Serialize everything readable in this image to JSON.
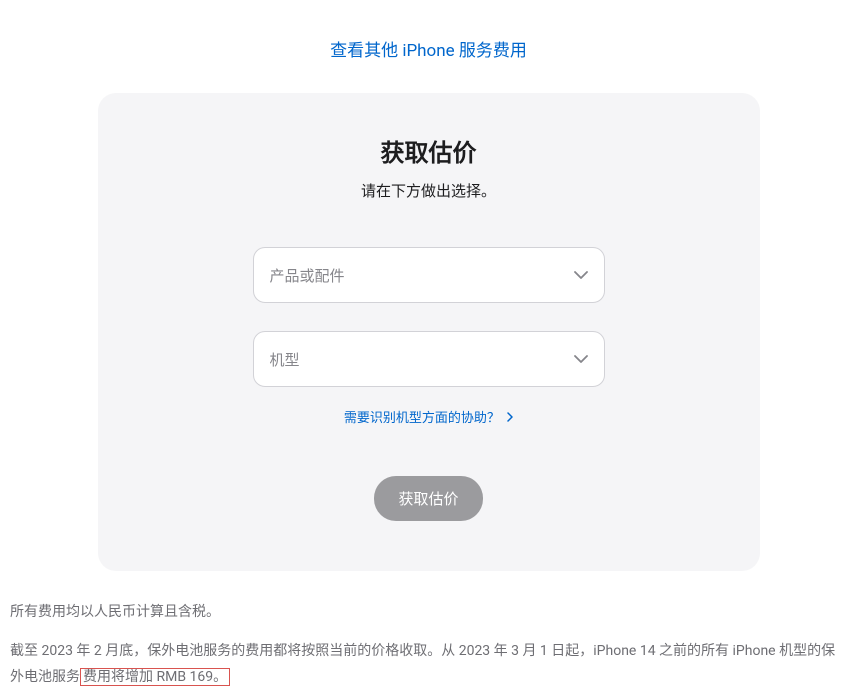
{
  "topLink": {
    "text": "查看其他 iPhone 服务费用"
  },
  "card": {
    "title": "获取估价",
    "subtitle": "请在下方做出选择。",
    "select1": {
      "placeholder": "产品或配件"
    },
    "select2": {
      "placeholder": "机型"
    },
    "helpLink": {
      "text": "需要识别机型方面的协助？"
    },
    "submit": {
      "label": "获取估价"
    }
  },
  "footer": {
    "line1": "所有费用均以人民币计算且含税。",
    "line2_part1": "截至 2023 年 2 月底，保外电池服务的费用都将按照当前的价格收取。从 2023 年 3 月 1 日起，iPhone 14 之前的所有 iPhone 机型的保外电池服务",
    "line2_highlight": "费用将增加 RMB 169。"
  }
}
